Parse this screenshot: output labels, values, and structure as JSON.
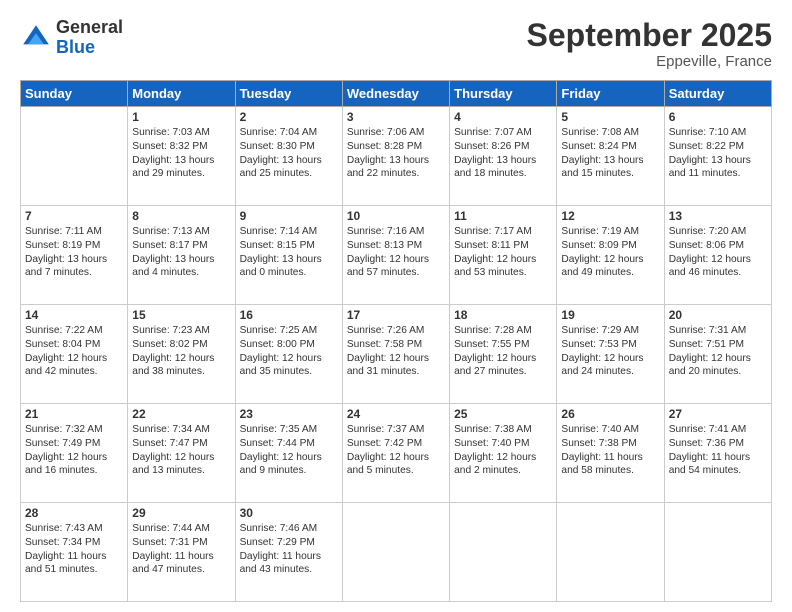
{
  "header": {
    "logo_general": "General",
    "logo_blue": "Blue",
    "month_title": "September 2025",
    "location": "Eppeville, France"
  },
  "weekdays": [
    "Sunday",
    "Monday",
    "Tuesday",
    "Wednesday",
    "Thursday",
    "Friday",
    "Saturday"
  ],
  "weeks": [
    [
      {
        "day": null,
        "content": null
      },
      {
        "day": "1",
        "content": "Sunrise: 7:03 AM\nSunset: 8:32 PM\nDaylight: 13 hours\nand 29 minutes."
      },
      {
        "day": "2",
        "content": "Sunrise: 7:04 AM\nSunset: 8:30 PM\nDaylight: 13 hours\nand 25 minutes."
      },
      {
        "day": "3",
        "content": "Sunrise: 7:06 AM\nSunset: 8:28 PM\nDaylight: 13 hours\nand 22 minutes."
      },
      {
        "day": "4",
        "content": "Sunrise: 7:07 AM\nSunset: 8:26 PM\nDaylight: 13 hours\nand 18 minutes."
      },
      {
        "day": "5",
        "content": "Sunrise: 7:08 AM\nSunset: 8:24 PM\nDaylight: 13 hours\nand 15 minutes."
      },
      {
        "day": "6",
        "content": "Sunrise: 7:10 AM\nSunset: 8:22 PM\nDaylight: 13 hours\nand 11 minutes."
      }
    ],
    [
      {
        "day": "7",
        "content": "Sunrise: 7:11 AM\nSunset: 8:19 PM\nDaylight: 13 hours\nand 7 minutes."
      },
      {
        "day": "8",
        "content": "Sunrise: 7:13 AM\nSunset: 8:17 PM\nDaylight: 13 hours\nand 4 minutes."
      },
      {
        "day": "9",
        "content": "Sunrise: 7:14 AM\nSunset: 8:15 PM\nDaylight: 13 hours\nand 0 minutes."
      },
      {
        "day": "10",
        "content": "Sunrise: 7:16 AM\nSunset: 8:13 PM\nDaylight: 12 hours\nand 57 minutes."
      },
      {
        "day": "11",
        "content": "Sunrise: 7:17 AM\nSunset: 8:11 PM\nDaylight: 12 hours\nand 53 minutes."
      },
      {
        "day": "12",
        "content": "Sunrise: 7:19 AM\nSunset: 8:09 PM\nDaylight: 12 hours\nand 49 minutes."
      },
      {
        "day": "13",
        "content": "Sunrise: 7:20 AM\nSunset: 8:06 PM\nDaylight: 12 hours\nand 46 minutes."
      }
    ],
    [
      {
        "day": "14",
        "content": "Sunrise: 7:22 AM\nSunset: 8:04 PM\nDaylight: 12 hours\nand 42 minutes."
      },
      {
        "day": "15",
        "content": "Sunrise: 7:23 AM\nSunset: 8:02 PM\nDaylight: 12 hours\nand 38 minutes."
      },
      {
        "day": "16",
        "content": "Sunrise: 7:25 AM\nSunset: 8:00 PM\nDaylight: 12 hours\nand 35 minutes."
      },
      {
        "day": "17",
        "content": "Sunrise: 7:26 AM\nSunset: 7:58 PM\nDaylight: 12 hours\nand 31 minutes."
      },
      {
        "day": "18",
        "content": "Sunrise: 7:28 AM\nSunset: 7:55 PM\nDaylight: 12 hours\nand 27 minutes."
      },
      {
        "day": "19",
        "content": "Sunrise: 7:29 AM\nSunset: 7:53 PM\nDaylight: 12 hours\nand 24 minutes."
      },
      {
        "day": "20",
        "content": "Sunrise: 7:31 AM\nSunset: 7:51 PM\nDaylight: 12 hours\nand 20 minutes."
      }
    ],
    [
      {
        "day": "21",
        "content": "Sunrise: 7:32 AM\nSunset: 7:49 PM\nDaylight: 12 hours\nand 16 minutes."
      },
      {
        "day": "22",
        "content": "Sunrise: 7:34 AM\nSunset: 7:47 PM\nDaylight: 12 hours\nand 13 minutes."
      },
      {
        "day": "23",
        "content": "Sunrise: 7:35 AM\nSunset: 7:44 PM\nDaylight: 12 hours\nand 9 minutes."
      },
      {
        "day": "24",
        "content": "Sunrise: 7:37 AM\nSunset: 7:42 PM\nDaylight: 12 hours\nand 5 minutes."
      },
      {
        "day": "25",
        "content": "Sunrise: 7:38 AM\nSunset: 7:40 PM\nDaylight: 12 hours\nand 2 minutes."
      },
      {
        "day": "26",
        "content": "Sunrise: 7:40 AM\nSunset: 7:38 PM\nDaylight: 11 hours\nand 58 minutes."
      },
      {
        "day": "27",
        "content": "Sunrise: 7:41 AM\nSunset: 7:36 PM\nDaylight: 11 hours\nand 54 minutes."
      }
    ],
    [
      {
        "day": "28",
        "content": "Sunrise: 7:43 AM\nSunset: 7:34 PM\nDaylight: 11 hours\nand 51 minutes."
      },
      {
        "day": "29",
        "content": "Sunrise: 7:44 AM\nSunset: 7:31 PM\nDaylight: 11 hours\nand 47 minutes."
      },
      {
        "day": "30",
        "content": "Sunrise: 7:46 AM\nSunset: 7:29 PM\nDaylight: 11 hours\nand 43 minutes."
      },
      {
        "day": null,
        "content": null
      },
      {
        "day": null,
        "content": null
      },
      {
        "day": null,
        "content": null
      },
      {
        "day": null,
        "content": null
      }
    ]
  ]
}
